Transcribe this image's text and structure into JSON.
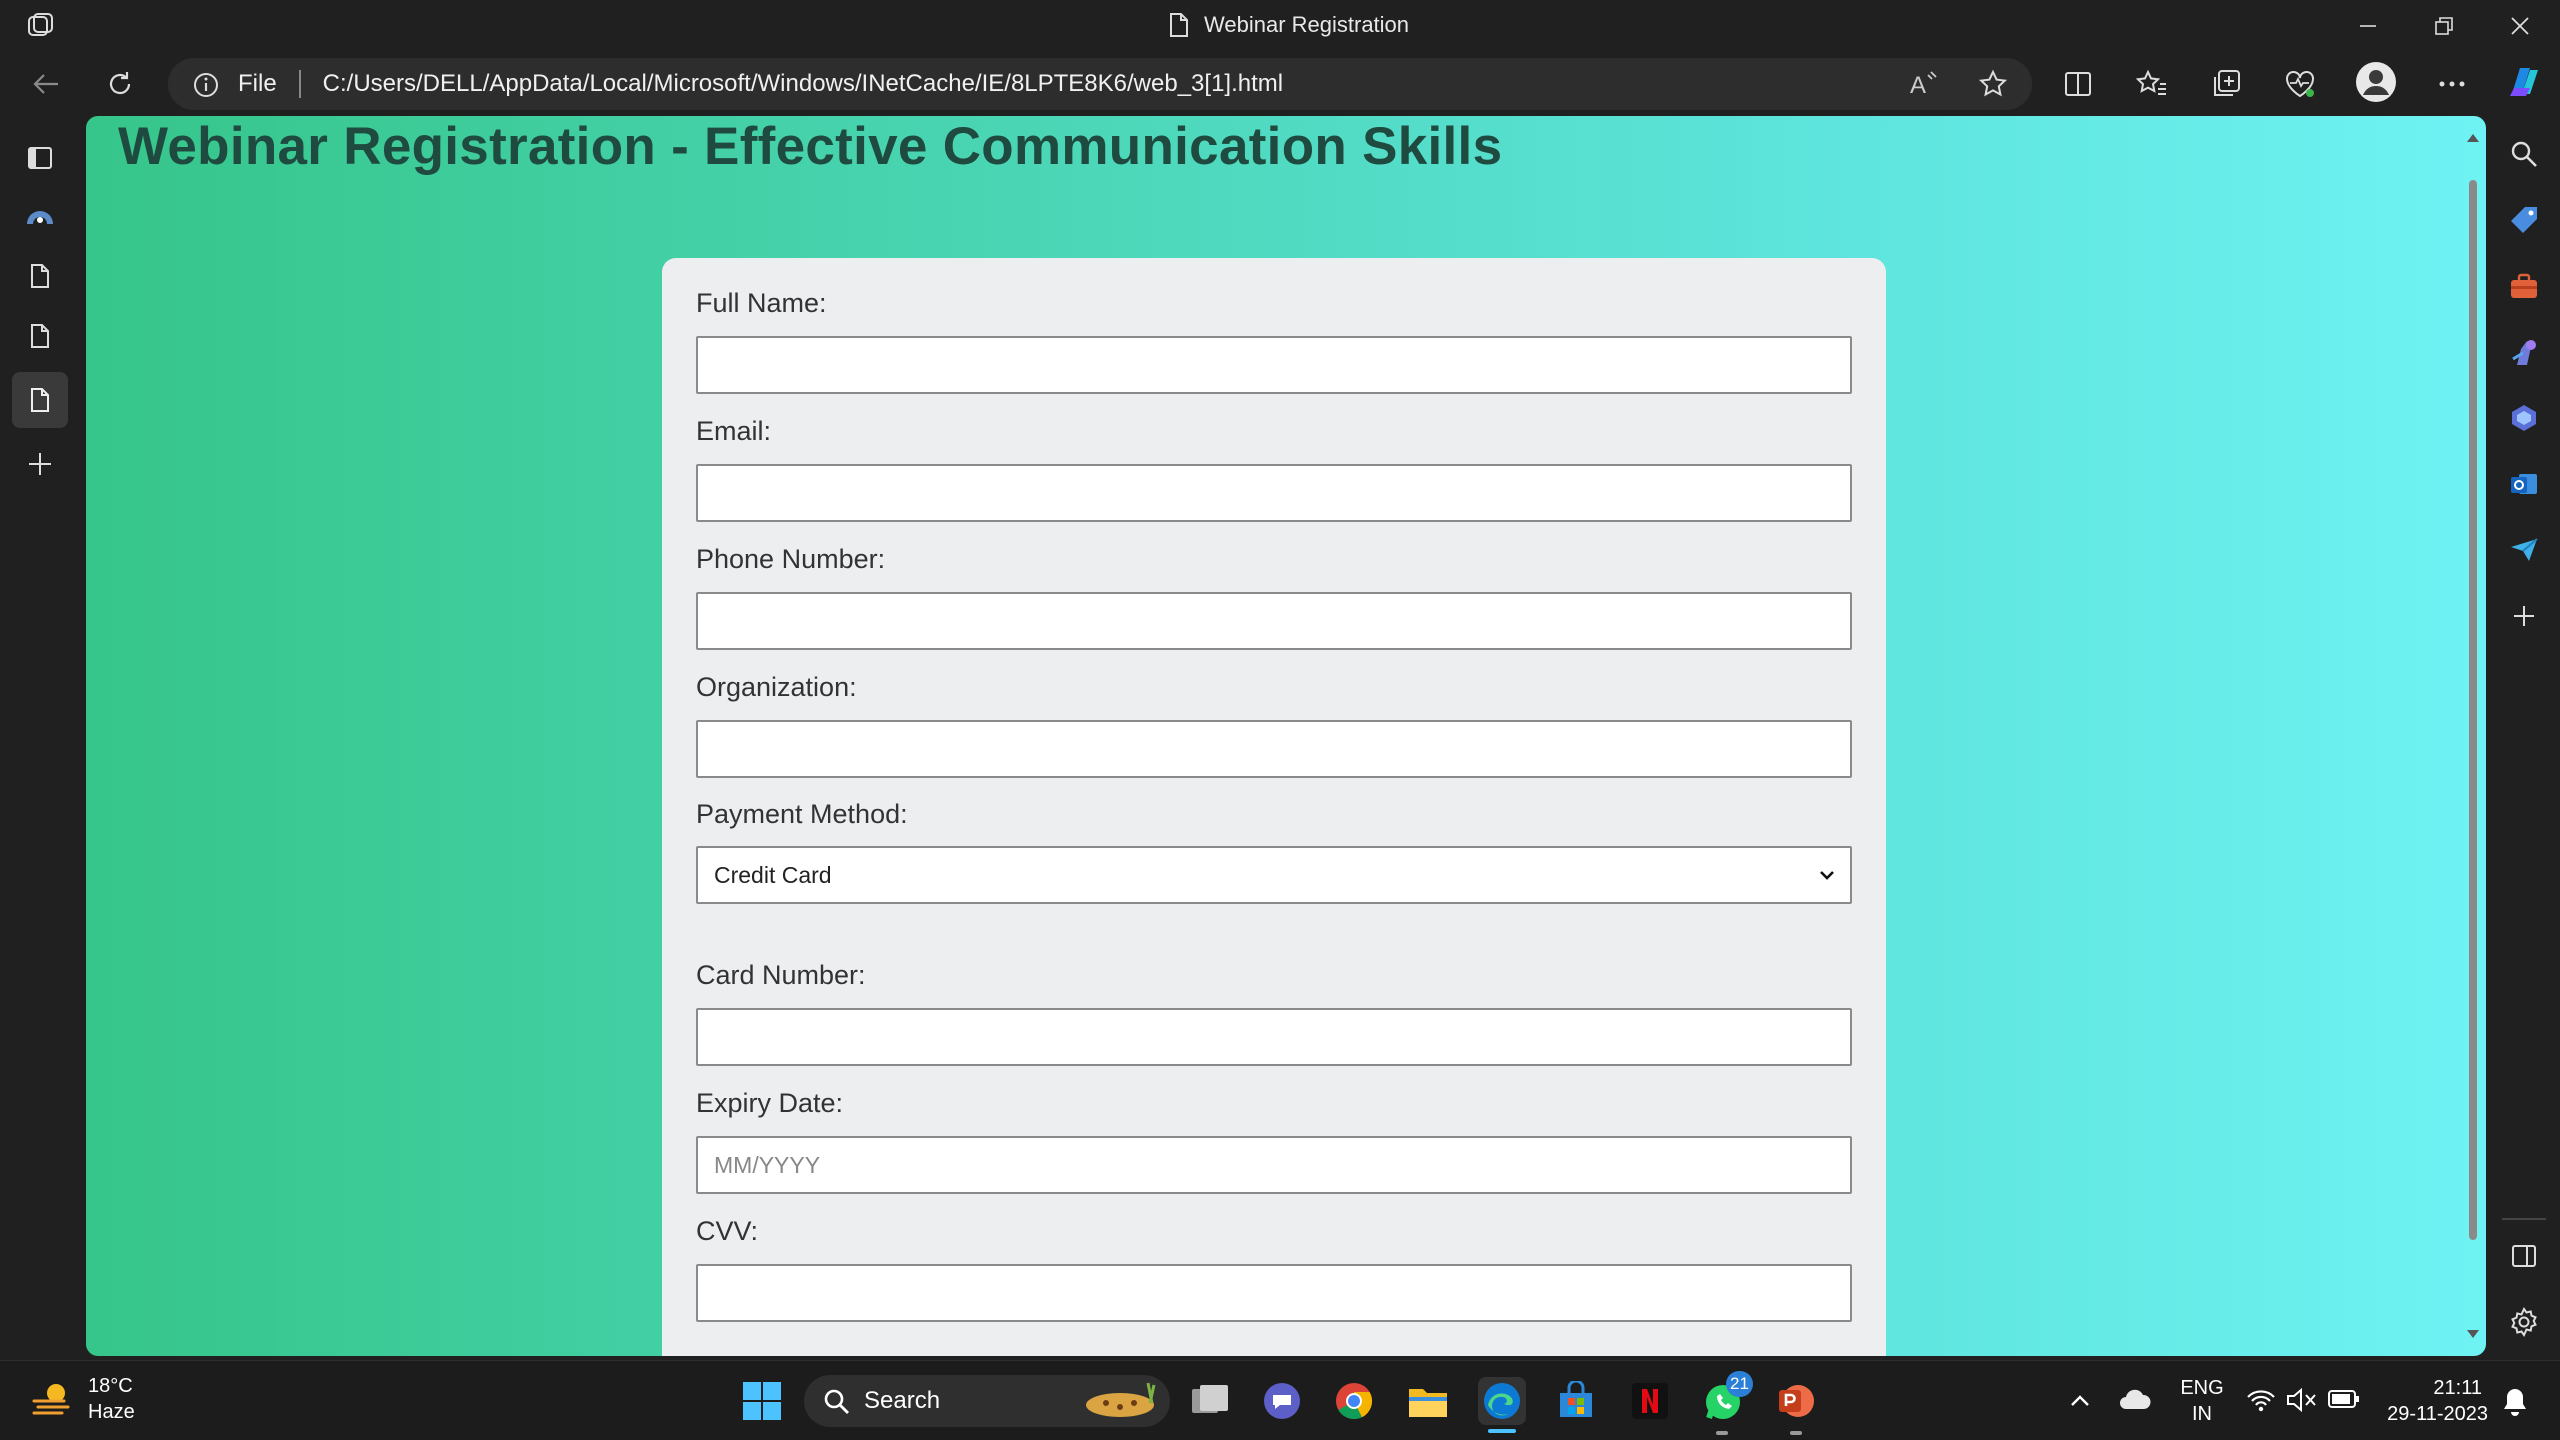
{
  "window": {
    "title": "Webinar Registration"
  },
  "address_bar": {
    "protocol_label": "File",
    "url": "C:/Users/DELL/AppData/Local/Microsoft/Windows/INetCache/IE/8LPTE8K6/web_3[1].html"
  },
  "page": {
    "title": "Webinar Registration - Effective Communication Skills",
    "form": {
      "full_name_label": "Full Name:",
      "email_label": "Email:",
      "phone_label": "Phone Number:",
      "organization_label": "Organization:",
      "payment_label": "Payment Method:",
      "payment_selected": "Credit Card",
      "card_number_label": "Card Number:",
      "expiry_label": "Expiry Date:",
      "expiry_placeholder": "MM/YYYY",
      "cvv_label": "CVV:"
    }
  },
  "taskbar": {
    "weather_temp": "18°C",
    "weather_desc": "Haze",
    "search_label": "Search",
    "whatsapp_badge": "21",
    "lang_top": "ENG",
    "lang_bottom": "IN",
    "time": "21:11",
    "date": "29-11-2023"
  },
  "colors": {
    "gradient_start": "#36c58a",
    "gradient_end": "#6ff2f3",
    "title_color": "#1f4a3f",
    "submit_button": "#101c7a"
  },
  "icons": {
    "toolbar": [
      "back-arrow-icon",
      "refresh-icon",
      "info-icon",
      "read-aloud-icon",
      "favorite-star-icon",
      "split-screen-icon",
      "favorites-icon",
      "collections-icon",
      "browser-essentials-icon",
      "profile-icon",
      "more-icon",
      "copilot-icon"
    ],
    "left_bar": [
      "tab-actions-icon",
      "edge-tab-icon",
      "page-tab-icon",
      "page-tab-icon",
      "page-tab-active-icon",
      "new-tab-plus-icon"
    ],
    "right_bar": [
      "search-icon",
      "shopping-tag-icon",
      "tools-icon",
      "games-icon",
      "office-icon",
      "outlook-icon",
      "send-icon",
      "add-icon",
      "sidebar-toggle-icon",
      "settings-gear-icon"
    ]
  }
}
